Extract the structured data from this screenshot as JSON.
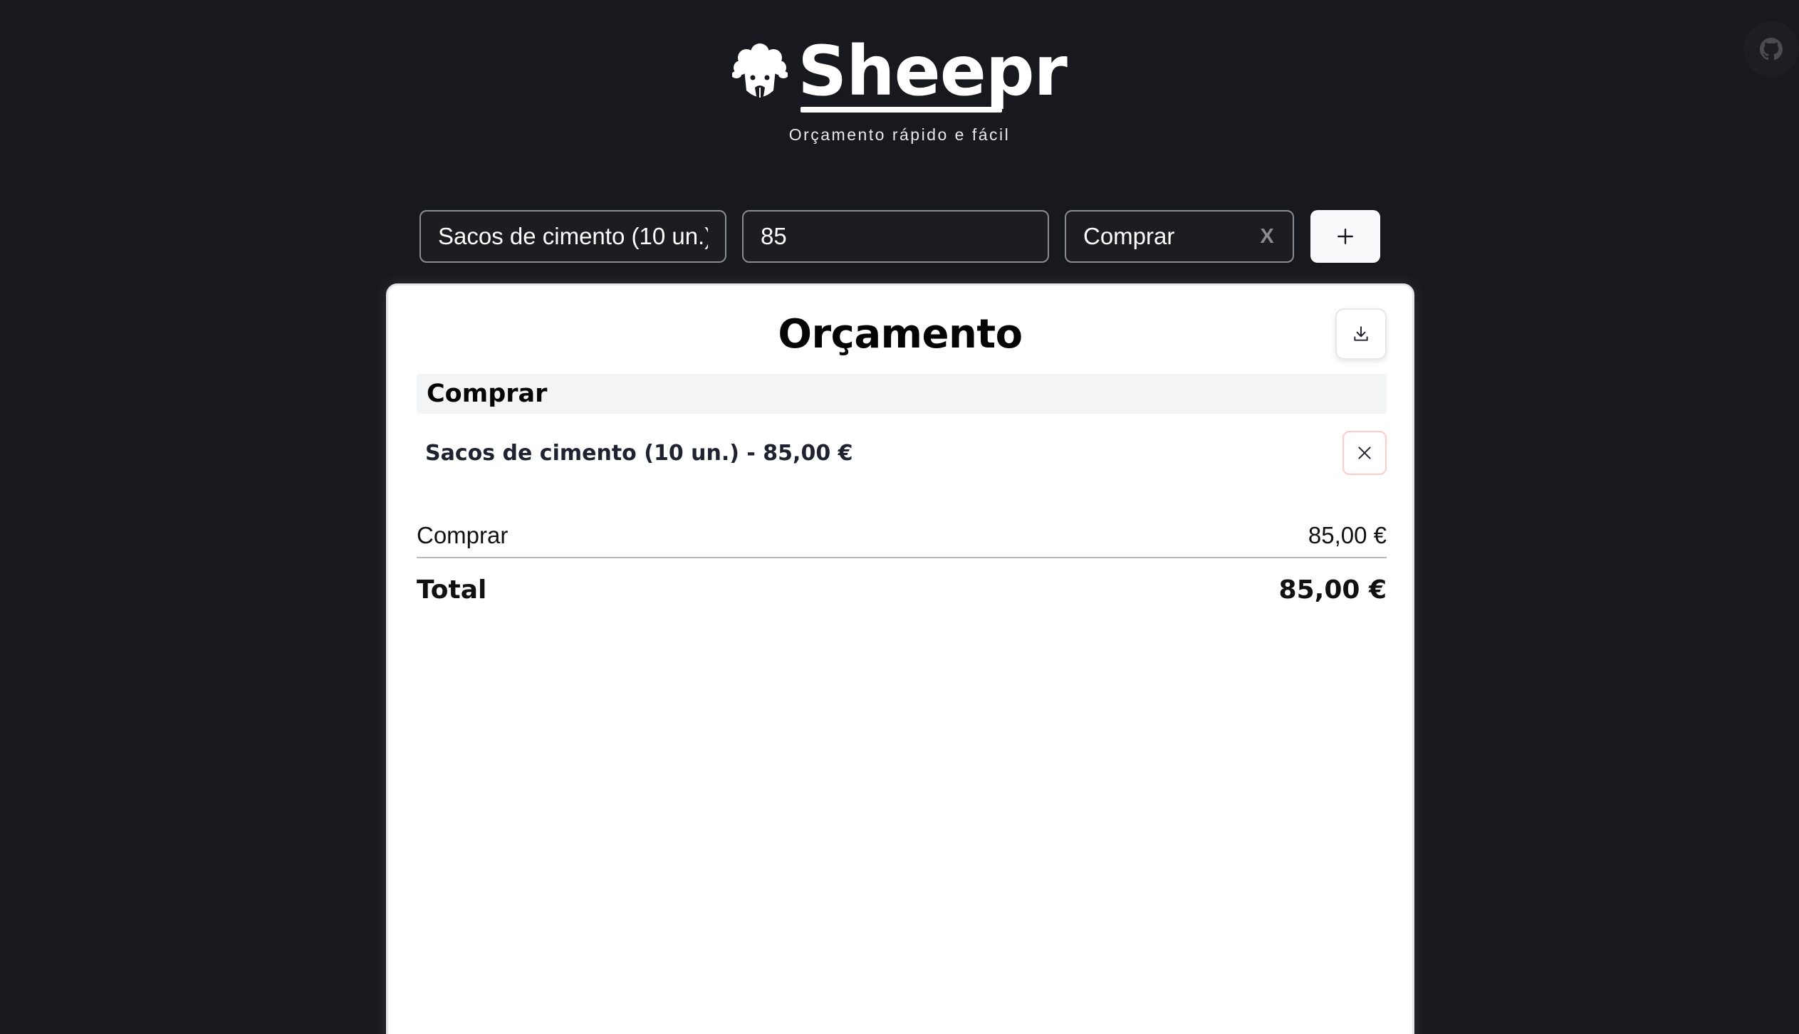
{
  "app": {
    "name": "Sheepr",
    "tagline": "Orçamento rápido e fácil",
    "logo_icon": "sheep-icon",
    "github_icon": "github-icon"
  },
  "form": {
    "name_value": "Sacos de cimento (10 un.)",
    "amount_value": "85",
    "category_value": "Comprar",
    "clear_label": "X",
    "add_icon": "plus-icon"
  },
  "budget": {
    "title": "Orçamento",
    "download_icon": "download-icon",
    "sections": [
      {
        "name": "Comprar",
        "items": [
          {
            "label": "Sacos de cimento (10 un.) - 85,00 €",
            "remove_icon": "close-icon"
          }
        ]
      }
    ],
    "summary": [
      {
        "label": "Comprar",
        "value": "85,00 €"
      }
    ],
    "total": {
      "label": "Total",
      "value": "85,00 €"
    }
  },
  "colors": {
    "background": "#18191e",
    "card": "#ffffff",
    "section_bg": "#f3f4f6",
    "remove_border": "#fecaca",
    "text_dark": "#111111"
  }
}
